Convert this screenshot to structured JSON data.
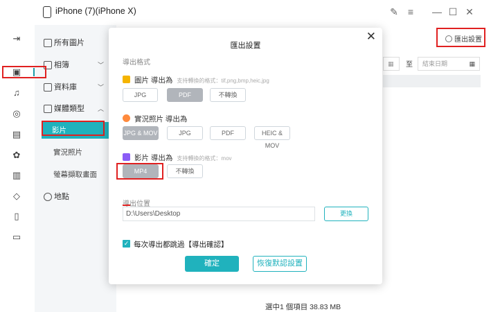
{
  "window": {
    "title": "iPhone (7)(iPhone X)",
    "controls": [
      "edit-icon",
      "menu-icon",
      "minimize-icon",
      "maximize-icon",
      "close-icon"
    ]
  },
  "rail": {
    "icons": [
      "back-icon",
      "photo-icon",
      "music-icon",
      "video-icon",
      "contacts-icon",
      "apps-icon",
      "books-icon",
      "tag-icon",
      "device-icon",
      "folder-icon"
    ]
  },
  "sidebar": {
    "items": [
      {
        "label": "所有圖片"
      },
      {
        "label": "相簿"
      },
      {
        "label": "資料庫"
      },
      {
        "label": "媒體類型"
      }
    ],
    "sub_items": [
      {
        "label": "影片"
      },
      {
        "label": "實況照片"
      },
      {
        "label": "螢幕擷取畫面"
      }
    ],
    "location": {
      "label": "地點"
    }
  },
  "main": {
    "export_settings_link": "匯出設置",
    "date_sep": "至",
    "end_date_placeholder": "結束日期",
    "status": "選中1 個項目 38.83 MB"
  },
  "modal": {
    "title": "匯出設置",
    "export_format_label": "導出格式",
    "photo": {
      "label": "圖片 導出為",
      "hint": "支持轉換的格式：tif,png,bmp,heic,jpg",
      "options": [
        "JPG",
        "PDF",
        "不轉換"
      ],
      "selected": "PDF"
    },
    "live": {
      "label": "實況照片 導出為",
      "options": [
        "JPG & MOV",
        "JPG",
        "PDF",
        "HEIC & MOV"
      ],
      "selected": "JPG & MOV"
    },
    "video": {
      "label": "影片 導出為",
      "hint": "支持轉換的格式：mov",
      "options": [
        "MP4",
        "不轉換"
      ],
      "selected": "MP4"
    },
    "location_label": "導出位置",
    "path": "D:\\Users\\Desktop",
    "change_button": "更換",
    "skip_confirm_label": "每次導出都跳過【導出確認】",
    "skip_confirm_checked": true,
    "ok_button": "確定",
    "reset_button": "恢復默認設置"
  },
  "colors": {
    "accent": "#20b2bd",
    "highlight": "#e02020",
    "selected_option": "#b1b5bb"
  }
}
